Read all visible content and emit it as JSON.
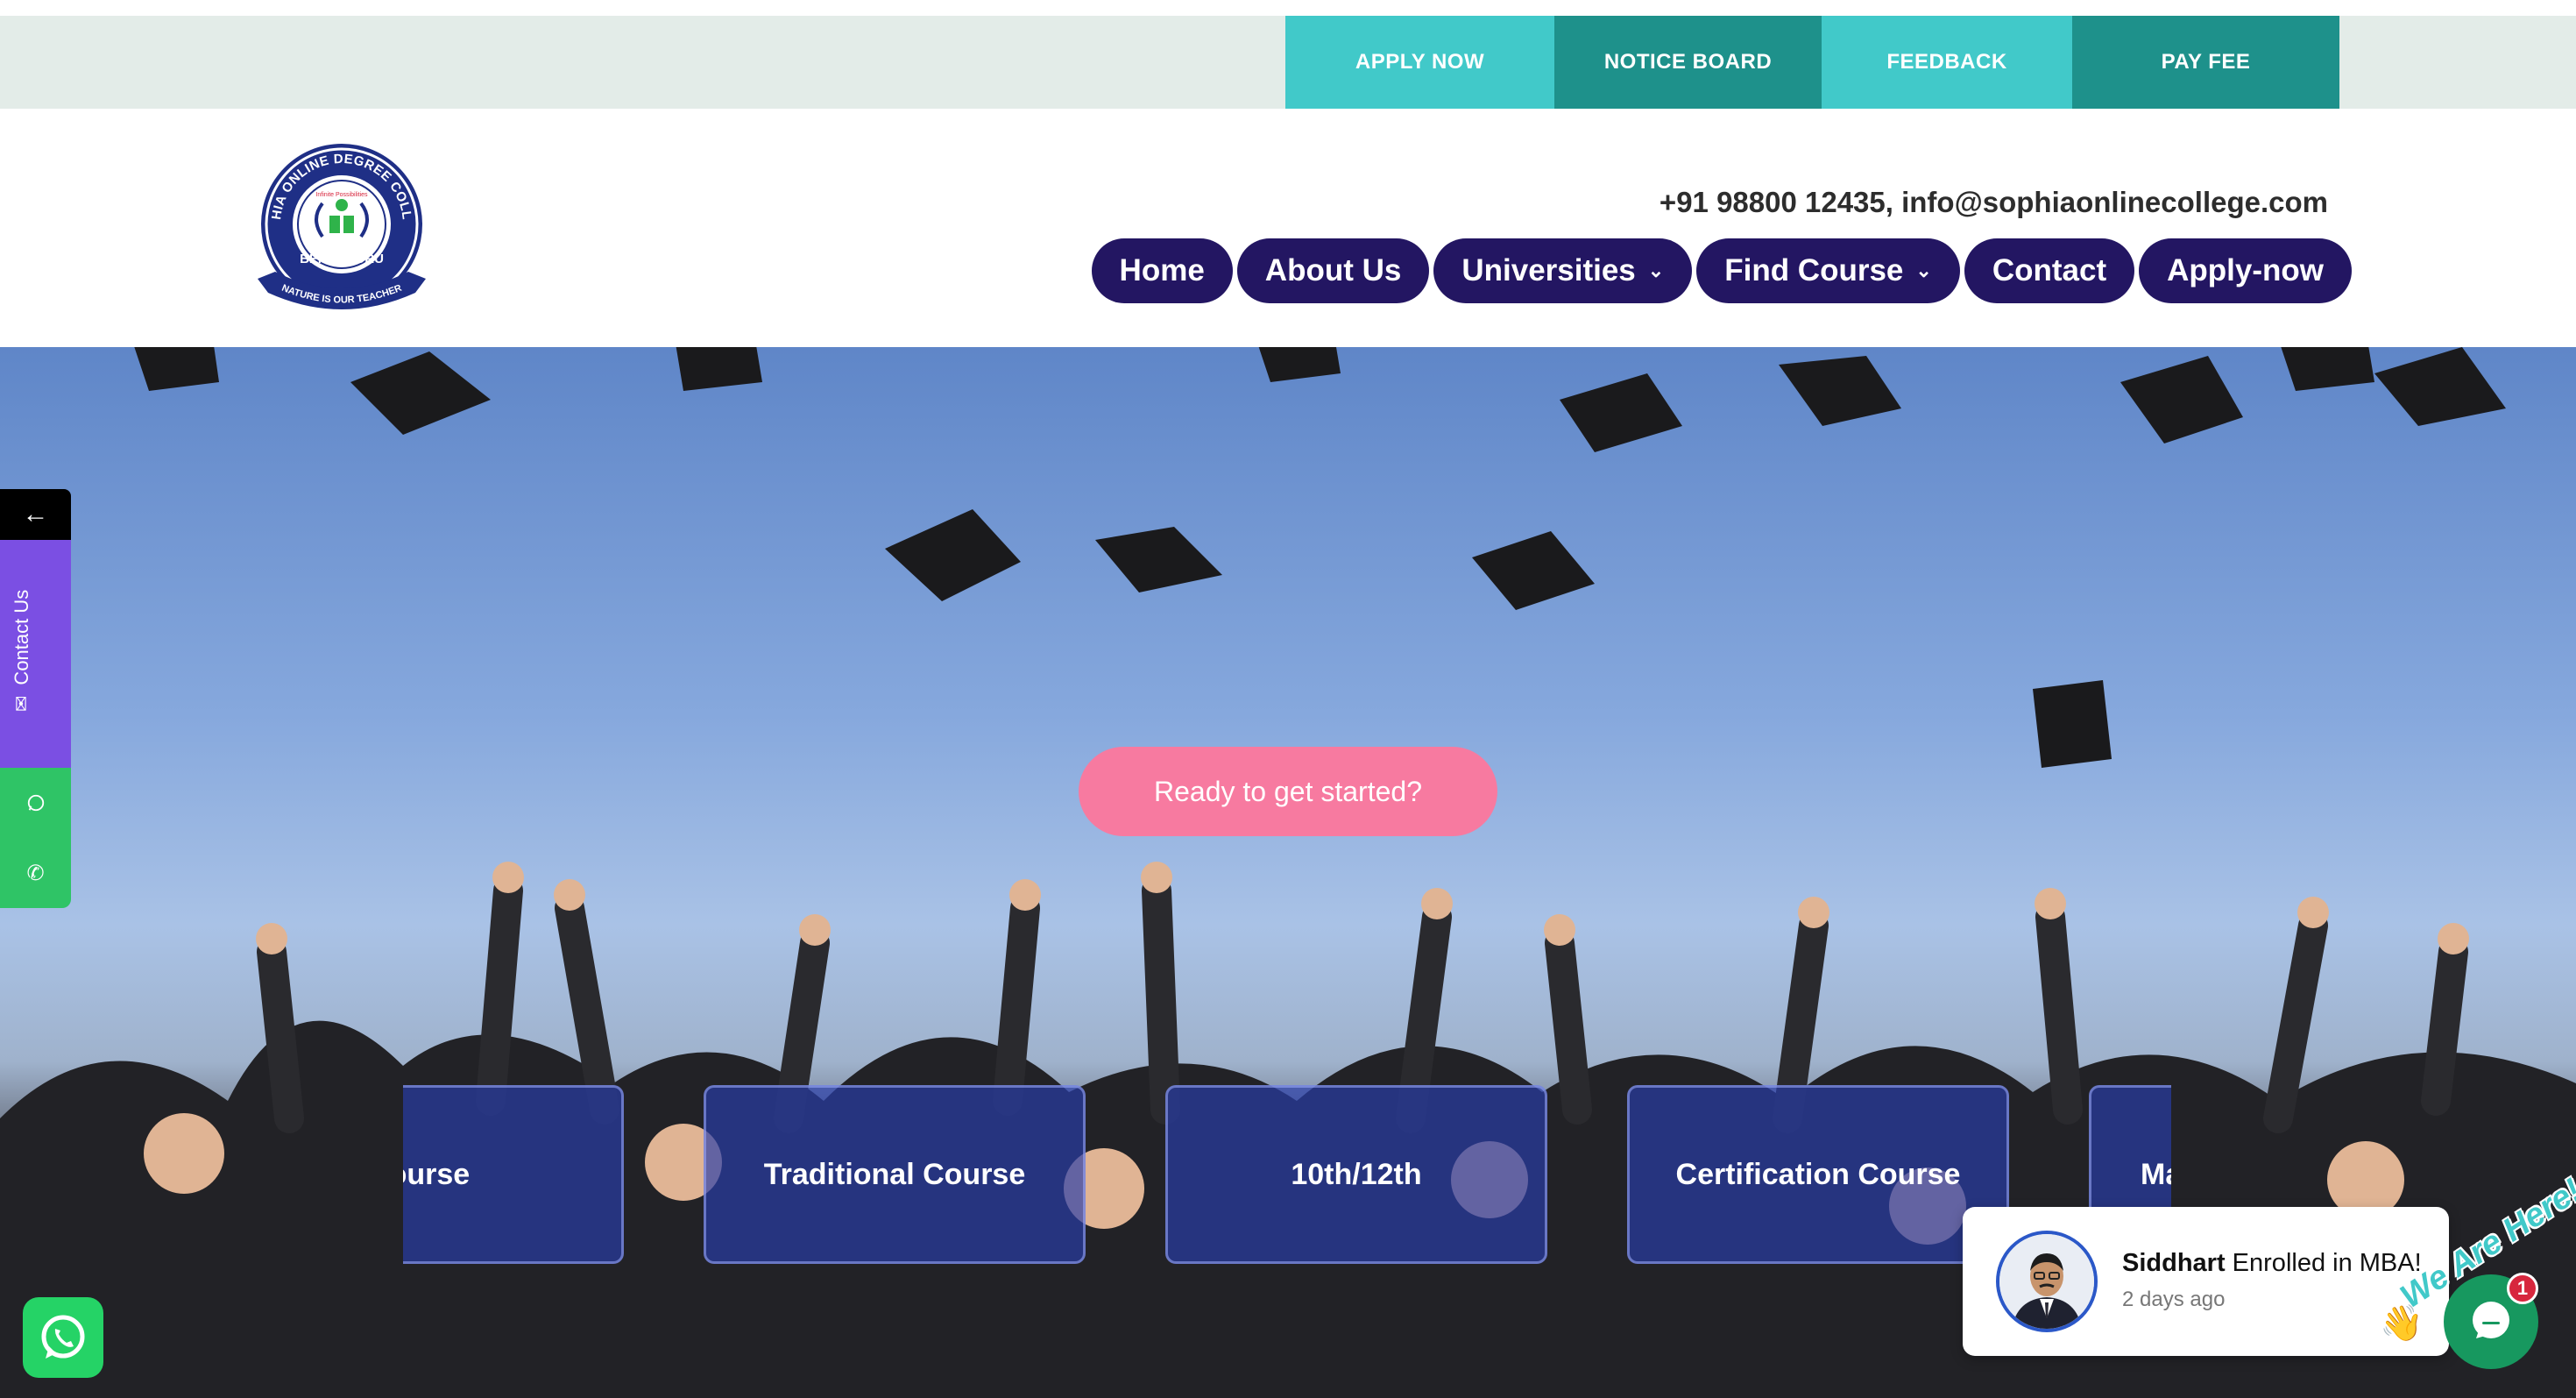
{
  "topbar": {
    "links": [
      {
        "label": "APPLY NOW",
        "tone": "light"
      },
      {
        "label": "NOTICE BOARD",
        "tone": "dark"
      },
      {
        "label": "FEEDBACK",
        "tone": "light"
      },
      {
        "label": "PAY FEE",
        "tone": "dark"
      }
    ]
  },
  "header": {
    "logo": {
      "ring_text": "SOPHIA ONLINE DEGREE COLLEGE",
      "motto": "Infinite Possibilities",
      "city": "BENGALURU",
      "banner": "NATURE IS OUR TEACHER",
      "icon": "college-seal-icon"
    },
    "contact_line": "+91 98800 12435, info@sophiaonlinecollege.com",
    "nav": [
      {
        "label": "Home",
        "dropdown": false
      },
      {
        "label": "About Us",
        "dropdown": false
      },
      {
        "label": "Universities",
        "dropdown": true
      },
      {
        "label": "Find Course",
        "dropdown": true
      },
      {
        "label": "Contact",
        "dropdown": false
      },
      {
        "label": "Apply-now",
        "dropdown": false
      }
    ]
  },
  "hero": {
    "cta_label": "Ready to get started?",
    "course_cards": [
      "ce Course",
      "Traditional Course",
      "10th/12th",
      "Certification Course",
      "Ma"
    ]
  },
  "side_panel": {
    "arrow": "←",
    "contact_label": "Contact Us",
    "icons": [
      "mail-icon",
      "whatsapp-icon",
      "phone-icon"
    ]
  },
  "notification": {
    "name": "Siddhart",
    "message": " Enrolled in MBA!",
    "time": "2 days ago"
  },
  "chat": {
    "tagline": "We Are Here!",
    "badge_count": "1",
    "wave": "👋"
  },
  "colors": {
    "topbar_bg": "#e3ece8",
    "teal_light": "#41c9c9",
    "teal_dark": "#1e918b",
    "nav_bg": "#231662",
    "cta_pink": "#f77aa0",
    "card_blue": "#283caa",
    "side_purple": "#7b4fe3",
    "whatsapp_green": "#25d366",
    "chat_green": "#17985f"
  }
}
